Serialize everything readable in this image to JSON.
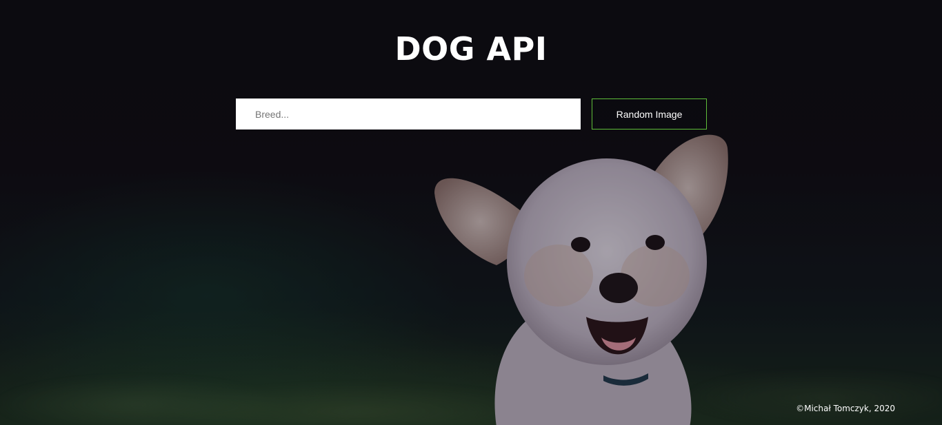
{
  "header": {
    "title": "DOG API"
  },
  "search": {
    "placeholder": "Breed...",
    "value": ""
  },
  "actions": {
    "random_label": "Random Image"
  },
  "footer": {
    "copyright": "©Michał Tomczyk, 2020"
  },
  "colors": {
    "button_border": "#5fbf3a",
    "title": "#ffffff",
    "background": "#0d0c10"
  }
}
